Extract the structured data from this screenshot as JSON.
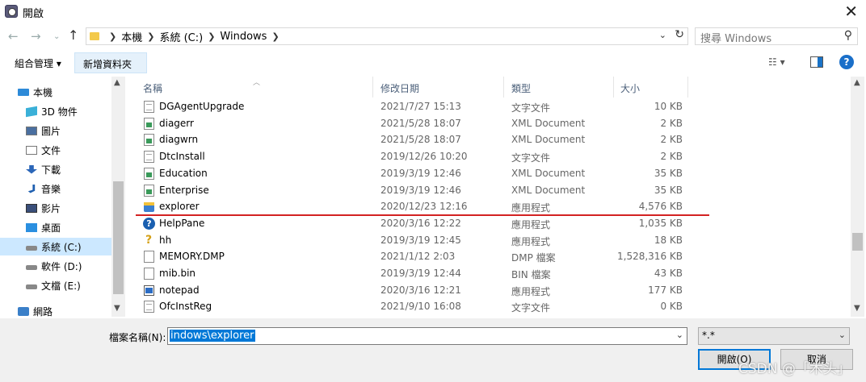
{
  "window": {
    "title": "開啟"
  },
  "address": {
    "crumbs": [
      "本機",
      "系統 (C:)",
      "Windows"
    ],
    "search_placeholder": "搜尋 Windows"
  },
  "toolbar": {
    "organize_label": "組合管理 ▾",
    "new_folder_label": "新增資料夾"
  },
  "sidebar": {
    "items": [
      {
        "label": "本機",
        "icon": "computer-icon",
        "selected": false
      },
      {
        "label": "3D 物件",
        "icon": "cube-icon",
        "selected": false
      },
      {
        "label": "圖片",
        "icon": "pictures-icon",
        "selected": false
      },
      {
        "label": "文件",
        "icon": "documents-icon",
        "selected": false
      },
      {
        "label": "下載",
        "icon": "download-icon",
        "selected": false
      },
      {
        "label": "音樂",
        "icon": "music-icon",
        "selected": false
      },
      {
        "label": "影片",
        "icon": "video-icon",
        "selected": false
      },
      {
        "label": "桌面",
        "icon": "desktop-icon",
        "selected": false
      },
      {
        "label": "系統 (C:)",
        "icon": "drive-icon",
        "selected": true
      },
      {
        "label": "軟件 (D:)",
        "icon": "drive-icon",
        "selected": false
      },
      {
        "label": "文檔 (E:)",
        "icon": "drive-icon",
        "selected": false
      },
      {
        "label": "網路",
        "icon": "network-icon",
        "selected": false
      }
    ]
  },
  "columns": {
    "name": "名稱",
    "date": "修改日期",
    "type": "類型",
    "size": "大小"
  },
  "files": [
    {
      "name": "DGAgentUpgrade",
      "date": "2021/7/27 15:13",
      "type": "文字文件",
      "size": "10 KB",
      "icon": "text"
    },
    {
      "name": "diagerr",
      "date": "2021/5/28 18:07",
      "type": "XML Document",
      "size": "2 KB",
      "icon": "xml"
    },
    {
      "name": "diagwrn",
      "date": "2021/5/28 18:07",
      "type": "XML Document",
      "size": "2 KB",
      "icon": "xml"
    },
    {
      "name": "DtcInstall",
      "date": "2019/12/26 10:20",
      "type": "文字文件",
      "size": "2 KB",
      "icon": "text"
    },
    {
      "name": "Education",
      "date": "2019/3/19 12:46",
      "type": "XML Document",
      "size": "35 KB",
      "icon": "xml"
    },
    {
      "name": "Enterprise",
      "date": "2019/3/19 12:46",
      "type": "XML Document",
      "size": "35 KB",
      "icon": "xml"
    },
    {
      "name": "explorer",
      "date": "2020/12/23 12:16",
      "type": "應用程式",
      "size": "4,576 KB",
      "icon": "exe"
    },
    {
      "name": "HelpPane",
      "date": "2020/3/16 12:22",
      "type": "應用程式",
      "size": "1,035 KB",
      "icon": "help"
    },
    {
      "name": "hh",
      "date": "2019/3/19 12:45",
      "type": "應用程式",
      "size": "18 KB",
      "icon": "hh"
    },
    {
      "name": "MEMORY.DMP",
      "date": "2021/1/12 2:03",
      "type": "DMP 檔案",
      "size": "1,528,316 KB",
      "icon": "blank"
    },
    {
      "name": "mib.bin",
      "date": "2019/3/19 12:44",
      "type": "BIN 檔案",
      "size": "43 KB",
      "icon": "blank"
    },
    {
      "name": "notepad",
      "date": "2020/3/16 12:21",
      "type": "應用程式",
      "size": "177 KB",
      "icon": "notepad"
    },
    {
      "name": "OfcInstReg",
      "date": "2021/9/10 16:08",
      "type": "文字文件",
      "size": "0 KB",
      "icon": "text"
    }
  ],
  "bottom": {
    "filename_label": "檔案名稱(N):",
    "filename_value": "indows\\explorer",
    "filter_value": "*.*",
    "open_label": "開啟(O)",
    "cancel_label": "取消"
  },
  "watermark": "CSDN @「木头」",
  "accent_color": "#0078d7",
  "annotation_color": "#d32222"
}
